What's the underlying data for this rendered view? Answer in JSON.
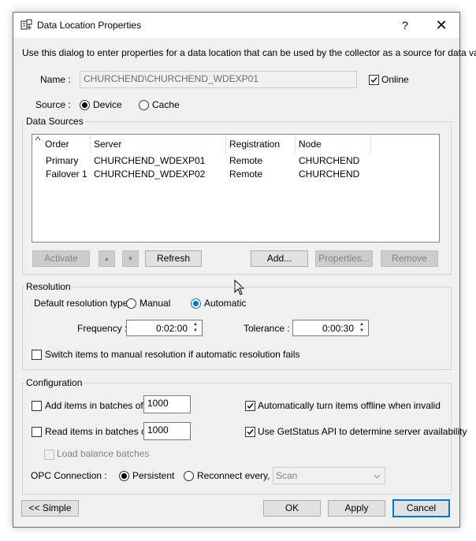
{
  "window": {
    "title": "Data Location Properties",
    "help_glyph": "?",
    "close_glyph": "✕"
  },
  "intro_text": "Use this dialog to enter properties for a data location that can be used by the collector as a source for data values.",
  "name_field": {
    "label": "Name :",
    "value": "CHURCHEND\\CHURCHEND_WDEXP01"
  },
  "online": {
    "label": "Online",
    "checked": true
  },
  "source": {
    "label": "Source :",
    "options": [
      "Device",
      "Cache"
    ],
    "selected": "Device"
  },
  "data_sources": {
    "group_label": "Data Sources",
    "columns": [
      "Order",
      "Server",
      "Registration",
      "Node"
    ],
    "rows": [
      {
        "order": "Primary",
        "server": "CHURCHEND_WDEXP01",
        "registration": "Remote",
        "node": "CHURCHEND"
      },
      {
        "order": "Failover 1",
        "server": "CHURCHEND_WDEXP02",
        "registration": "Remote",
        "node": "CHURCHEND"
      }
    ],
    "buttons": {
      "activate": "Activate",
      "up": "▲",
      "down": "▼",
      "refresh": "Refresh",
      "add": "Add...",
      "properties": "Properties...",
      "remove": "Remove"
    }
  },
  "resolution": {
    "group_label": "Resolution",
    "type_label": "Default resolution type :",
    "manual_label": "Manual",
    "automatic_label": "Automatic",
    "selected": "Automatic",
    "frequency_label": "Frequency :",
    "frequency_value": "0:02:00",
    "tolerance_label": "Tolerance :",
    "tolerance_value": "0:00:30",
    "switch_label": "Switch items to manual resolution if automatic resolution fails"
  },
  "configuration": {
    "group_label": "Configuration",
    "add_batches_label": "Add items in batches of",
    "add_batches_value": "1000",
    "read_batches_label": "Read items in batches of",
    "read_batches_value": "1000",
    "load_balance_label": "Load balance batches",
    "auto_offline_label": "Automatically turn items offline when invalid",
    "getstatus_label": "Use GetStatus API to determine server availability",
    "opc_label": "OPC Connection :",
    "persistent_label": "Persistent",
    "reconnect_label": "Reconnect every,",
    "reconnect_value": "Scan",
    "selected": "Persistent"
  },
  "footer": {
    "simple": "<< Simple",
    "ok": "OK",
    "apply": "Apply",
    "cancel": "Cancel"
  },
  "colors": {
    "accent": "#0078d7",
    "window_bg": "#f0f0f0"
  }
}
